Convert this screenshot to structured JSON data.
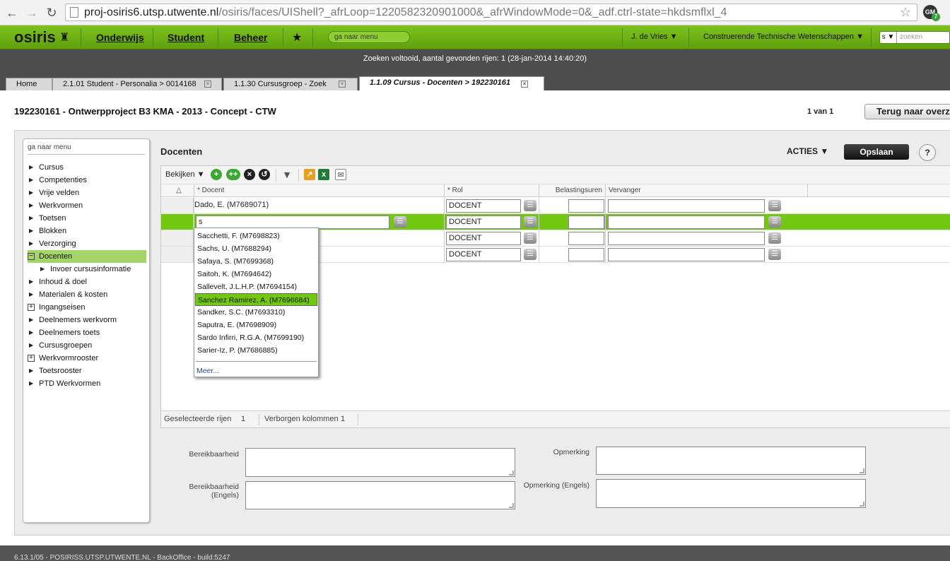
{
  "browser": {
    "url_host": "proj-osiris6.utsp.utwente.nl",
    "url_path": "/osiris/faces/UIShell?_afrLoop=1220582320901000&_afrWindowMode=0&_adf.ctrl-state=hkdsmflxl_4",
    "ext_label": "GM",
    "ext_badge": "7"
  },
  "appbar": {
    "logo": "osiris",
    "nav": [
      "Onderwijs",
      "Student",
      "Beheer"
    ],
    "goto_menu": "ga naar menu",
    "user": "J. de Vries",
    "faculty": "Construerende Technische Wetenschappen",
    "search_scope": "s",
    "search_placeholder": "zoeken"
  },
  "status": "Zoeken voltooid, aantal gevonden rijen: 1 (28-jan-2014 14:40:20)",
  "tabs": [
    {
      "label": "Home"
    },
    {
      "label": "2.1.01 Student - Personalia > 0014168"
    },
    {
      "label": "1.1.30 Cursusgroep - Zoek"
    },
    {
      "label": "1.1.09 Cursus - Docenten > 192230161"
    }
  ],
  "page": {
    "title": "192230161 - Ontwerpproject B3 KMA - 2013 - Concept - CTW",
    "count": "1 van 1",
    "back_button": "Terug naar overzicht"
  },
  "sidemenu": {
    "search": "ga naar menu",
    "items": [
      "Cursus",
      "Competenties",
      "Vrije velden",
      "Werkvormen",
      "Toetsen",
      "Blokken",
      "Verzorging",
      "Docenten",
      "Invoer cursusinformatie",
      "Inhoud & doel",
      "Materialen & kosten",
      "Ingangseisen",
      "Deelnemers werkvorm",
      "Deelnemers toets",
      "Cursusgroepen",
      "Werkvormrooster",
      "Toetsrooster",
      "PTD Werkvormen"
    ]
  },
  "section": {
    "title": "Docenten",
    "acties": "ACTIES",
    "save": "Opslaan",
    "help": "?",
    "view_menu": "Bekijken"
  },
  "table": {
    "columns": [
      "* Docent",
      "* Rol",
      "Belastingsuren",
      "Vervanger"
    ],
    "rows": [
      {
        "docent": "Dado, E. (M7689071)",
        "rol": "DOCENT",
        "uren": "",
        "vervanger": ""
      },
      {
        "docent": "s",
        "rol": "DOCENT",
        "uren": "",
        "vervanger": ""
      },
      {
        "docent": "",
        "rol": "DOCENT",
        "uren": "",
        "vervanger": ""
      },
      {
        "docent": "",
        "rol": "DOCENT",
        "uren": "",
        "vervanger": ""
      }
    ],
    "footer": {
      "selected_label": "Geselecteerde rijen",
      "selected_count": "1",
      "hidden_label": "Verborgen kolommen",
      "hidden_count": "1"
    }
  },
  "dropdown": {
    "items": [
      "Sacchetti, F. (M7698823)",
      "Sachs, U. (M7688294)",
      "Safaya, S. (M7699368)",
      "Saitoh, K. (M7694642)",
      "Sallevelt, J.L.H.P. (M7694154)",
      "Sanchez Ramirez, A. (M7696684)",
      "Sandker, S.C. (M7693310)",
      "Saputra, E. (M7698909)",
      "Sardo Infirri, R.G.A. (M7699190)",
      "Sarier-Iz, P. (M7686885)"
    ],
    "highlighted_index": 5,
    "more": "Meer..."
  },
  "form": {
    "bereikbaarheid": "Bereikbaarheid",
    "bereikbaarheid_engels_1": "Bereikbaarheid",
    "bereikbaarheid_engels_2": "(Engels)",
    "opmerking": "Opmerking",
    "opmerking_engels": "Opmerking (Engels)"
  },
  "footer_text": "6.13.1/05 - POSIRISS.UTSP.UTWENTE.NL - BackOffice - build:5247",
  "colors": {
    "brand_green": "#72c811",
    "status_bg": "#4d4d4d"
  }
}
